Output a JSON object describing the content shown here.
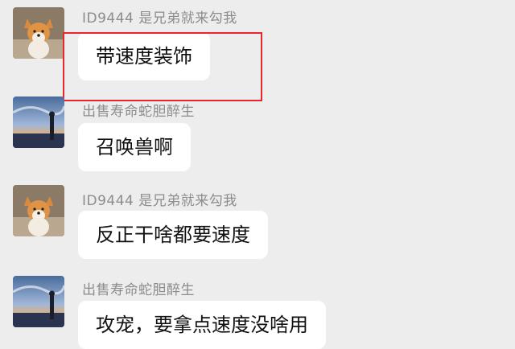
{
  "messages": [
    {
      "sender": "ID9444 是兄弟就来勾我",
      "text": "带速度装饰",
      "avatar": "corgi-avatar"
    },
    {
      "sender": "出售寿命蛇胆醉生",
      "text": "召唤兽啊",
      "avatar": "sunset-avatar"
    },
    {
      "sender": "ID9444 是兄弟就来勾我",
      "text": "反正干啥都要速度",
      "avatar": "corgi-avatar"
    },
    {
      "sender": "出售寿命蛇胆醉生",
      "text": "攻宠，要拿点速度没啥用",
      "avatar": "sunset-avatar"
    }
  ],
  "colors": {
    "background": "#ededed",
    "bubble": "#ffffff",
    "sender_text": "#8c8c8c",
    "highlight": "#e8262a"
  }
}
